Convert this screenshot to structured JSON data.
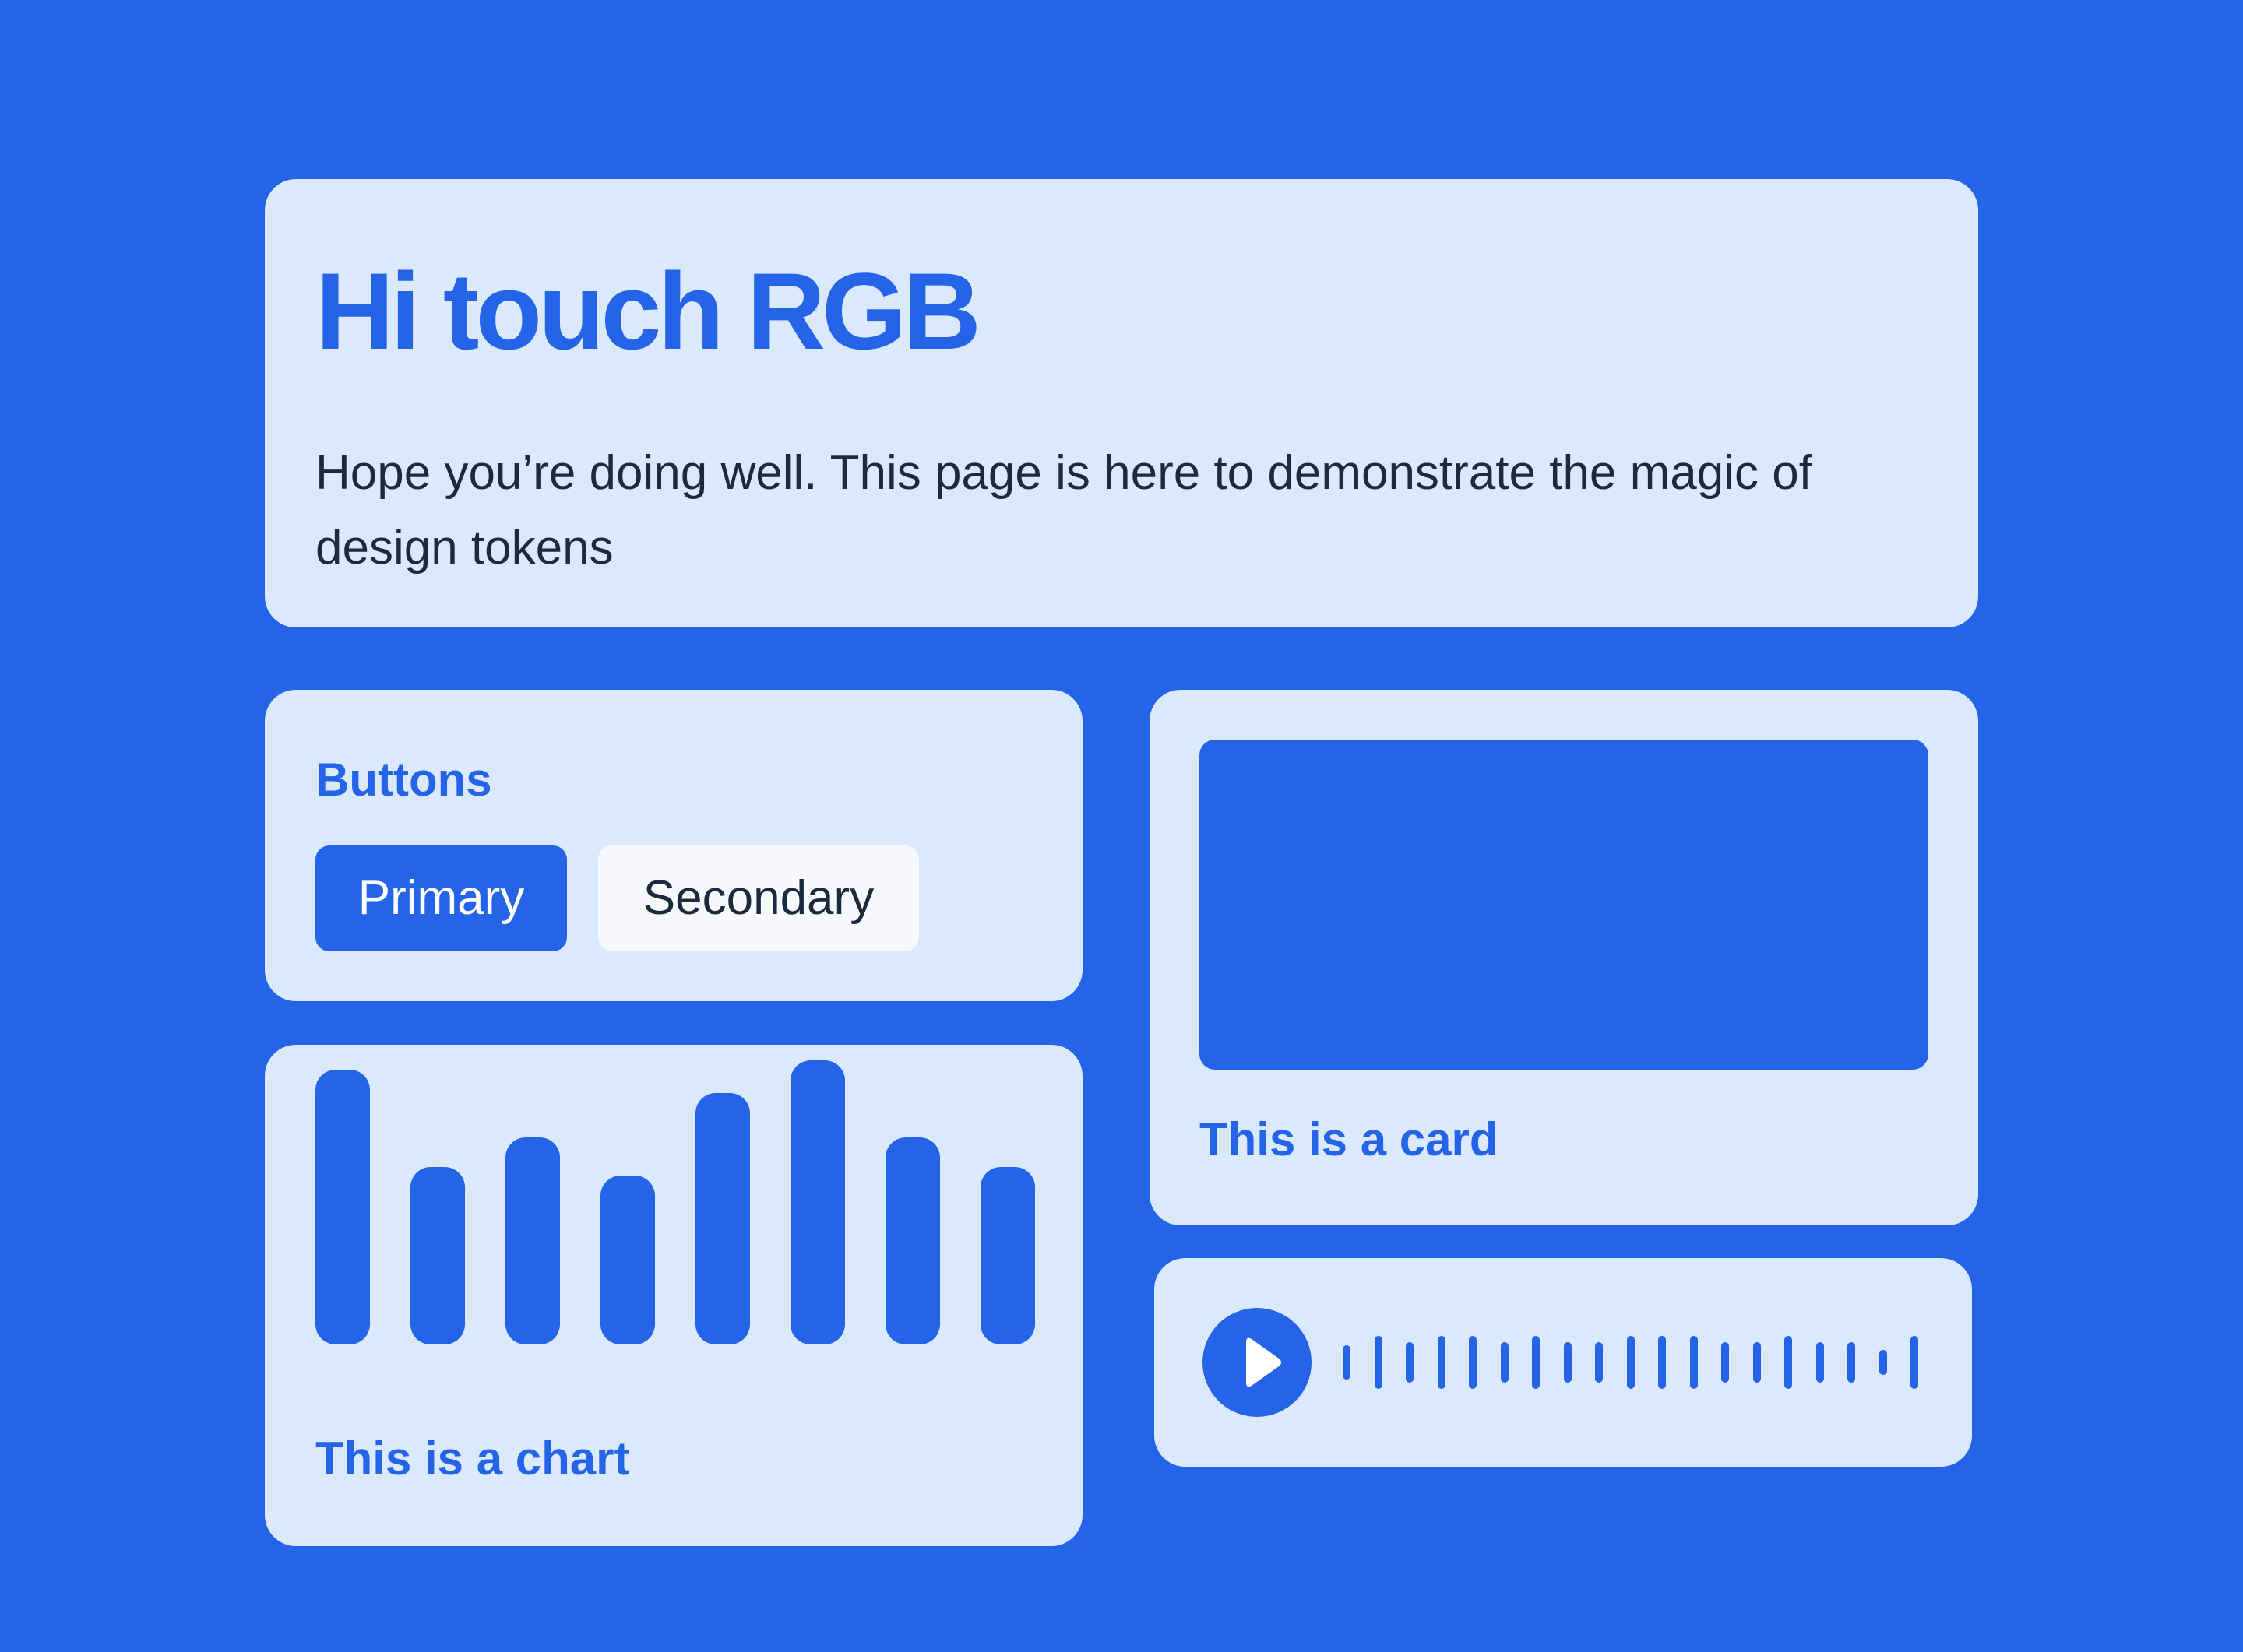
{
  "hero": {
    "title": "Hi touch RGB",
    "body": "Hope you’re doing well. This page is here to demonstrate the magic of design tokens"
  },
  "buttons_section": {
    "title": "Buttons",
    "primary_label": "Primary",
    "secondary_label": "Secondary"
  },
  "chart_section": {
    "caption": "This is a chart"
  },
  "chart_data": {
    "type": "bar",
    "values": [
      0.93,
      0.6,
      0.7,
      0.57,
      0.85,
      0.96,
      0.7,
      0.6
    ]
  },
  "card_section": {
    "caption": "This is a card"
  },
  "audio_player": {
    "play_icon": "play-icon",
    "waveform_levels": [
      0.55,
      0.85,
      0.65,
      0.85,
      0.85,
      0.65,
      0.85,
      0.65,
      0.65,
      0.85,
      0.85,
      0.85,
      0.65,
      0.65,
      0.85,
      0.65,
      0.65,
      0.4,
      0.85
    ]
  },
  "colors": {
    "background": "#2563e8",
    "surface": "#dbe9fd",
    "accent": "#2563e8",
    "text": "#1c2a3f",
    "secondary_button": "#f7f9fc"
  }
}
